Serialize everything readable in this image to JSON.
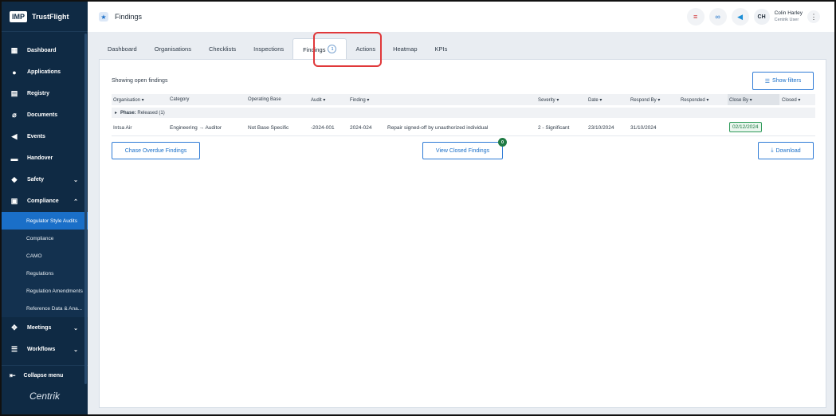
{
  "brand": {
    "logo": "IMP",
    "name": "TrustFlight"
  },
  "sidebar": {
    "items": [
      {
        "label": "Dashboard",
        "icon": "dashboard-icon",
        "glyph": "▦"
      },
      {
        "label": "Applications",
        "icon": "person-icon",
        "glyph": "●"
      },
      {
        "label": "Registry",
        "icon": "registry-icon",
        "glyph": "▤"
      },
      {
        "label": "Documents",
        "icon": "paperclip-icon",
        "glyph": "⌀"
      },
      {
        "label": "Events",
        "icon": "megaphone-icon",
        "glyph": "◀"
      },
      {
        "label": "Handover",
        "icon": "handover-icon",
        "glyph": "▬"
      },
      {
        "label": "Safety",
        "icon": "shield-icon",
        "glyph": "◆"
      },
      {
        "label": "Compliance",
        "icon": "compliance-icon",
        "glyph": "▣"
      }
    ],
    "compliance_sub": [
      "Regulator Style Audits",
      "Compliance",
      "CAMO",
      "Regulations",
      "Regulation Amendments",
      "Reference Data & Ana..."
    ],
    "after": [
      {
        "label": "Meetings",
        "icon": "meetings-icon",
        "glyph": "✥"
      },
      {
        "label": "Workflows",
        "icon": "workflows-icon",
        "glyph": "☰"
      }
    ],
    "collapse_label": "Collapse menu",
    "footer_logo": "Centrik"
  },
  "header": {
    "title": "Findings",
    "user_initials": "CH",
    "user_name": "Colin Harley",
    "user_role": "Centrik User"
  },
  "tabs": [
    {
      "label": "Dashboard"
    },
    {
      "label": "Organisations"
    },
    {
      "label": "Checklists"
    },
    {
      "label": "Inspections"
    },
    {
      "label": "Findings",
      "count": "1",
      "active": true
    },
    {
      "label": "Actions"
    },
    {
      "label": "Heatmap"
    },
    {
      "label": "KPIs"
    }
  ],
  "main": {
    "showing_text": "Showing open findings",
    "show_filters_label": "Show filters",
    "columns": [
      "Organisation ▾",
      "Category",
      "Operating Base",
      "Audit ▾",
      "Finding ▾",
      "Severity ▾",
      "Date ▾",
      "Respond By ▾",
      "Responded ▾",
      "Close By ▾",
      "Closed ▾"
    ],
    "phase_label": "Phase:",
    "phase_value": "Released (1)",
    "row": {
      "organisation": "Intsa Air",
      "category": "Engineering → Auditor",
      "operating_base": "Not Base Specific",
      "audit": "-2024-001",
      "finding_id": "2024-024",
      "finding_text": "Repair signed-off by unauthorized individual",
      "severity": "2 - Significant",
      "date": "23/10/2024",
      "respond_by": "31/10/2024",
      "responded": "",
      "close_by": "02/12/2024",
      "closed": ""
    },
    "chase_label": "Chase Overdue Findings",
    "view_closed_label": "View Closed Findings",
    "view_closed_count": "0",
    "download_label": "Download"
  }
}
